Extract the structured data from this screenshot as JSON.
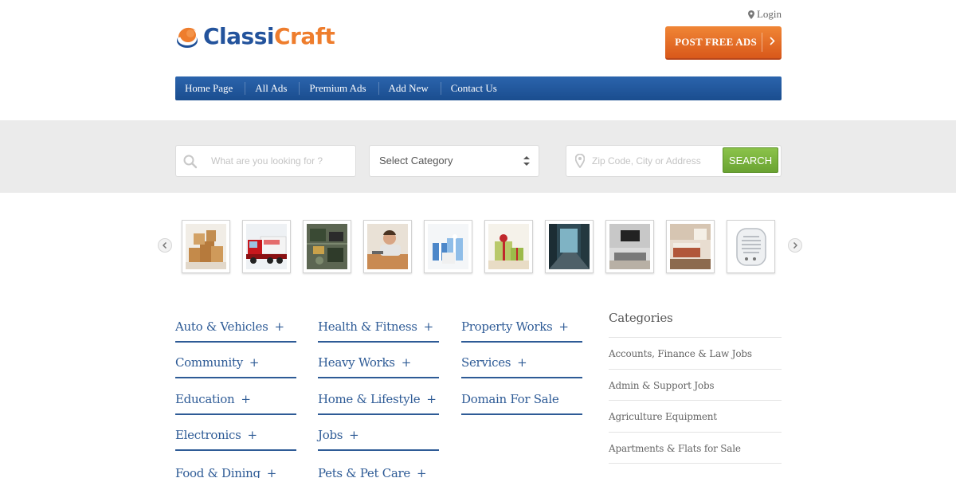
{
  "brand": {
    "name_part1": "Classi",
    "name_part2": "Craft",
    "blue": "#23539c",
    "orange": "#ee7d2d"
  },
  "header": {
    "login_label": "Login",
    "post_ads_label": "POST FREE ADS"
  },
  "nav": {
    "items": [
      {
        "label": "Home Page"
      },
      {
        "label": "All Ads"
      },
      {
        "label": "Premium Ads"
      },
      {
        "label": "Add New"
      },
      {
        "label": "Contact Us"
      }
    ]
  },
  "search": {
    "keyword_placeholder": "What are you looking for ?",
    "category_selected": "Select Category",
    "location_placeholder": "Zip Code, City or Address",
    "button_label": "SEARCH"
  },
  "carousel": {
    "images": [
      {
        "icon": "boxes"
      },
      {
        "icon": "truck"
      },
      {
        "icon": "circuit-board"
      },
      {
        "icon": "worker"
      },
      {
        "icon": "gifts-blue"
      },
      {
        "icon": "gifts-green"
      },
      {
        "icon": "hallway"
      },
      {
        "icon": "living-room"
      },
      {
        "icon": "bedroom"
      },
      {
        "icon": "heater"
      }
    ]
  },
  "categories_grid": {
    "col1": [
      {
        "label": "Auto & Vehicles",
        "plus": "+"
      },
      {
        "label": "Community",
        "plus": "+"
      },
      {
        "label": "Education",
        "plus": "+"
      },
      {
        "label": "Electronics",
        "plus": "+"
      },
      {
        "label": "Food & Dining",
        "plus": "+"
      }
    ],
    "col2": [
      {
        "label": "Health & Fitness",
        "plus": "+"
      },
      {
        "label": "Heavy Works",
        "plus": "+"
      },
      {
        "label": "Home & Lifestyle",
        "plus": "+"
      },
      {
        "label": "Jobs",
        "plus": "+"
      },
      {
        "label": "Pets & Pet Care",
        "plus": "+"
      }
    ],
    "col3": [
      {
        "label": "Property Works",
        "plus": "+"
      },
      {
        "label": "Services",
        "plus": "+"
      },
      {
        "label": "Domain For Sale",
        "plus": ""
      }
    ]
  },
  "sidebar": {
    "title": "Categories",
    "items": [
      {
        "label": "Accounts, Finance & Law Jobs"
      },
      {
        "label": "Admin & Support Jobs"
      },
      {
        "label": "Agriculture Equipment"
      },
      {
        "label": "Apartments & Flats for Sale"
      }
    ]
  }
}
